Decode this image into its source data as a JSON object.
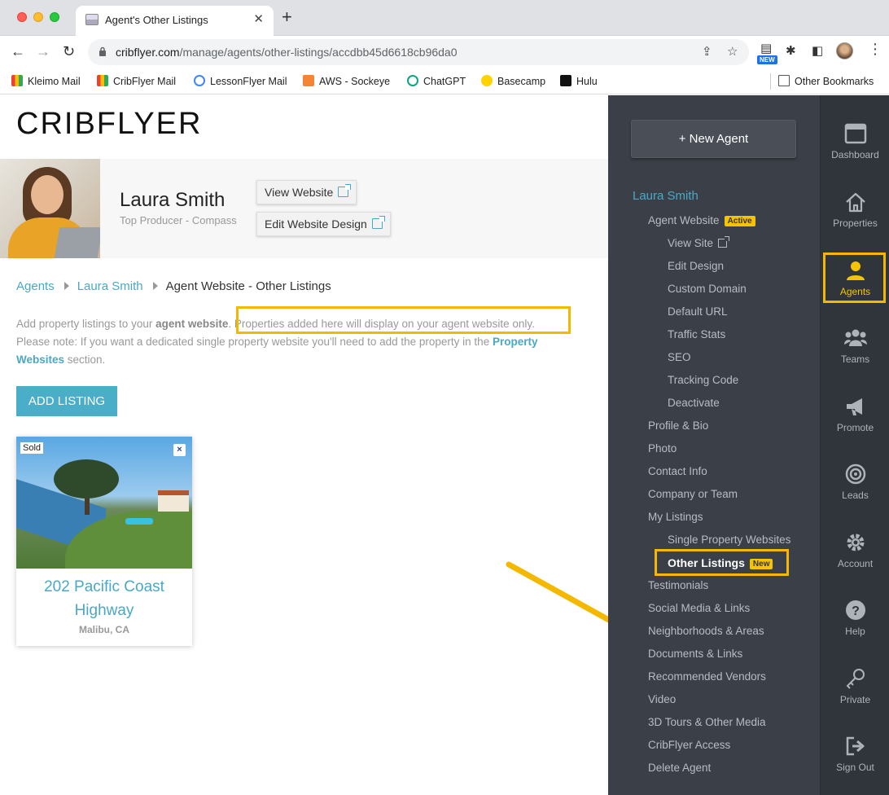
{
  "browser": {
    "tab_title": "Agent's Other Listings",
    "url_host": "cribflyer.com",
    "url_path": "/manage/agents/other-listings/accdbb45d6618cb96da0",
    "new_badge": "NEW",
    "bookmarks": [
      "Kleimo Mail",
      "CribFlyer Mail",
      "LessonFlyer Mail",
      "AWS - Sockeye",
      "ChatGPT",
      "Basecamp",
      "Hulu"
    ],
    "other_bookmarks": "Other Bookmarks"
  },
  "page": {
    "logo": "CRIBFLYER",
    "agent_name": "Laura Smith",
    "agent_subtitle": "Top Producer - Compass",
    "view_website": "View Website",
    "edit_website_design": "Edit Website Design",
    "breadcrumb": [
      "Agents",
      "Laura Smith",
      "Agent Website - Other Listings"
    ],
    "info_part1": "Add property listings to your ",
    "info_bold": "agent website",
    "info_part2": ". Properties added here will display on your agent website only.",
    "info_part3": "Please note: If you want a dedicated single property website you'll need to add the property in the ",
    "info_link": "Property Websites",
    "info_part4": " section.",
    "add_listing": "ADD LISTING",
    "listing": {
      "tag": "Sold",
      "remove": "×",
      "title_line1": "202 Pacific Coast",
      "title_line2": "Highway",
      "location": "Malibu, CA"
    }
  },
  "sidebar": {
    "new_agent": "+ New Agent",
    "agent": "Laura Smith",
    "items": [
      {
        "label": "Agent Website",
        "badge": "Active"
      },
      {
        "label": "View Site"
      },
      {
        "label": "Edit Design"
      },
      {
        "label": "Custom Domain"
      },
      {
        "label": "Default URL"
      },
      {
        "label": "Traffic Stats"
      },
      {
        "label": "SEO"
      },
      {
        "label": "Tracking Code"
      },
      {
        "label": "Deactivate"
      },
      {
        "label": "Profile & Bio"
      },
      {
        "label": "Photo"
      },
      {
        "label": "Contact Info"
      },
      {
        "label": "Company or Team"
      },
      {
        "label": "My Listings"
      },
      {
        "label": "Single Property Websites"
      },
      {
        "label": "Other Listings",
        "badge": "New"
      },
      {
        "label": "Testimonials"
      },
      {
        "label": "Social Media & Links"
      },
      {
        "label": "Neighborhoods & Areas"
      },
      {
        "label": "Documents & Links"
      },
      {
        "label": "Recommended Vendors"
      },
      {
        "label": "Video"
      },
      {
        "label": "3D Tours & Other Media"
      },
      {
        "label": "CribFlyer Access"
      },
      {
        "label": "Delete Agent"
      }
    ]
  },
  "rail": [
    "Dashboard",
    "Properties",
    "Agents",
    "Teams",
    "Promote",
    "Leads",
    "Account",
    "Help",
    "Private",
    "Sign Out"
  ],
  "colors": {
    "accent": "#4aa8c6",
    "highlight": "#f5b800",
    "sidebar": "#3b4048",
    "rail": "#30343b"
  }
}
